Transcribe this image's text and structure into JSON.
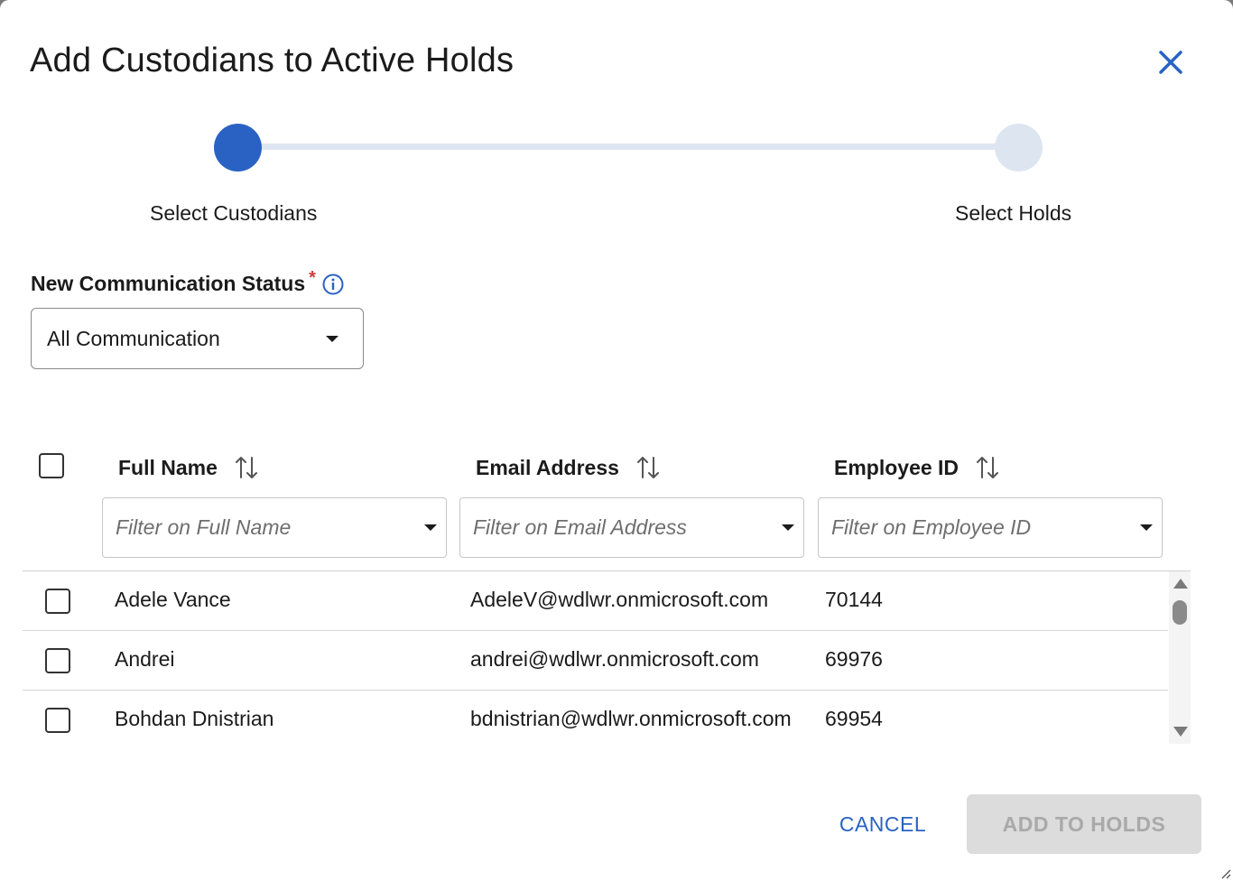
{
  "dialog": {
    "title": "Add Custodians to Active Holds"
  },
  "stepper": {
    "steps": [
      {
        "label": "Select Custodians",
        "state": "active"
      },
      {
        "label": "Select Holds",
        "state": "inactive"
      }
    ]
  },
  "communication_status": {
    "label": "New Communication Status",
    "required_mark": "*",
    "selected": "All Communication"
  },
  "table": {
    "columns": [
      {
        "label": "Full Name",
        "filter_placeholder": "Filter on Full Name"
      },
      {
        "label": "Email Address",
        "filter_placeholder": "Filter on Email Address"
      },
      {
        "label": "Employee ID",
        "filter_placeholder": "Filter on Employee ID"
      }
    ],
    "rows": [
      {
        "name": "Adele Vance",
        "email": "AdeleV@wdlwr.onmicrosoft.com",
        "employee_id": "70144"
      },
      {
        "name": "Andrei",
        "email": "andrei@wdlwr.onmicrosoft.com",
        "employee_id": "69976"
      },
      {
        "name": "Bohdan Dnistrian",
        "email": "bdnistrian@wdlwr.onmicrosoft.com",
        "employee_id": "69954"
      }
    ]
  },
  "footer": {
    "cancel_label": "CANCEL",
    "submit_label": "ADD TO HOLDS",
    "submit_enabled": false
  },
  "colors": {
    "accent": "#2a62c4",
    "step_inactive": "#dde6f0",
    "required": "#d23b3b",
    "disabled_button_bg": "#dcdcdc",
    "disabled_button_text": "#a9a9a9"
  }
}
